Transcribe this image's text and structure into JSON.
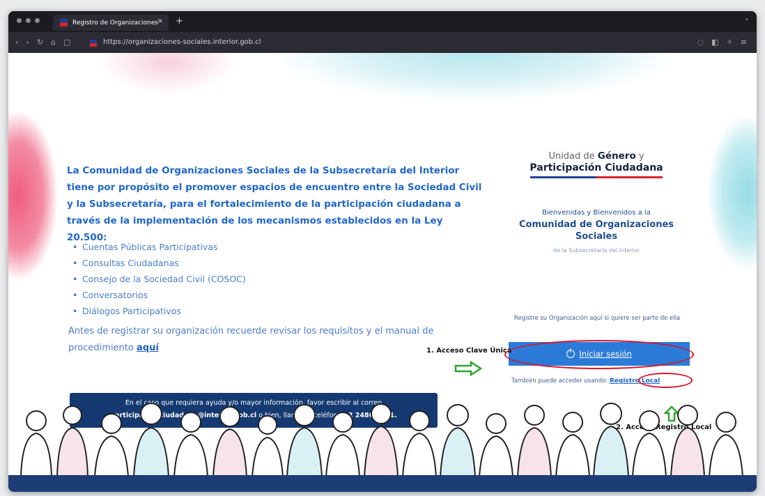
{
  "browser": {
    "tab_title": "Registro de Organizaciones",
    "tab_close": "×",
    "new_tab": "+",
    "url": "https://organizaciones-sociales.interior.gob.cl"
  },
  "main": {
    "intro": "La Comunidad de Organizaciones Sociales de la Subsecretaría del Interior tiene por propósito el promover espacios de encuentro entre la Sociedad Civil y la Subsecretaría, para el fortalecimiento de la participación ciudadana a través de la implementación de los mecanismos establecidos en la Ley 20.500:",
    "bullets": [
      "Cuentas Públicas Participativas",
      "Consultas Ciudadanas",
      "Consejo de la Sociedad Civil (COSOC)",
      "Conversatorios",
      "Diálogos Participativos"
    ],
    "reminder_text": "Antes de registrar su organización recuerde revisar los requisitos y el manual de procedimiento ",
    "reminder_link": "aquí",
    "help_line1": "En el caso que requiera ayuda y/o mayor información, favor escribir al correo",
    "help_email": "participacionciudadana@interior.gob.cl",
    "help_mid": " o bien, llamar al teléfono ",
    "help_phone": "22 2486 3261."
  },
  "panel": {
    "logo_line1_a": "Unidad de ",
    "logo_line1_b": "Género",
    "logo_line1_c": " y",
    "logo_line2": "Participación Ciudadana",
    "welcome1": "Bienvenidas y Bienvenidos a la",
    "welcome2": "Comunidad de Organizaciones Sociales",
    "welcome3": "de la Subsecretaría del Interior",
    "register_note": "Registre su Organización aquí si quiere ser parte de ella",
    "login_label": "Iniciar sesión",
    "alt_text": "También puede acceder usando: ",
    "alt_link": "Registro Local"
  },
  "annotations": {
    "clave_unica": "1. Acceso Clave Única",
    "registro_local": "2. Acceso Registro Local",
    "color": "#d6122b",
    "arrow_color": "#2fa52f"
  },
  "colors": {
    "primary_blue": "#2b7ad8",
    "navy": "#153a72",
    "text_blue": "#2167c9"
  }
}
